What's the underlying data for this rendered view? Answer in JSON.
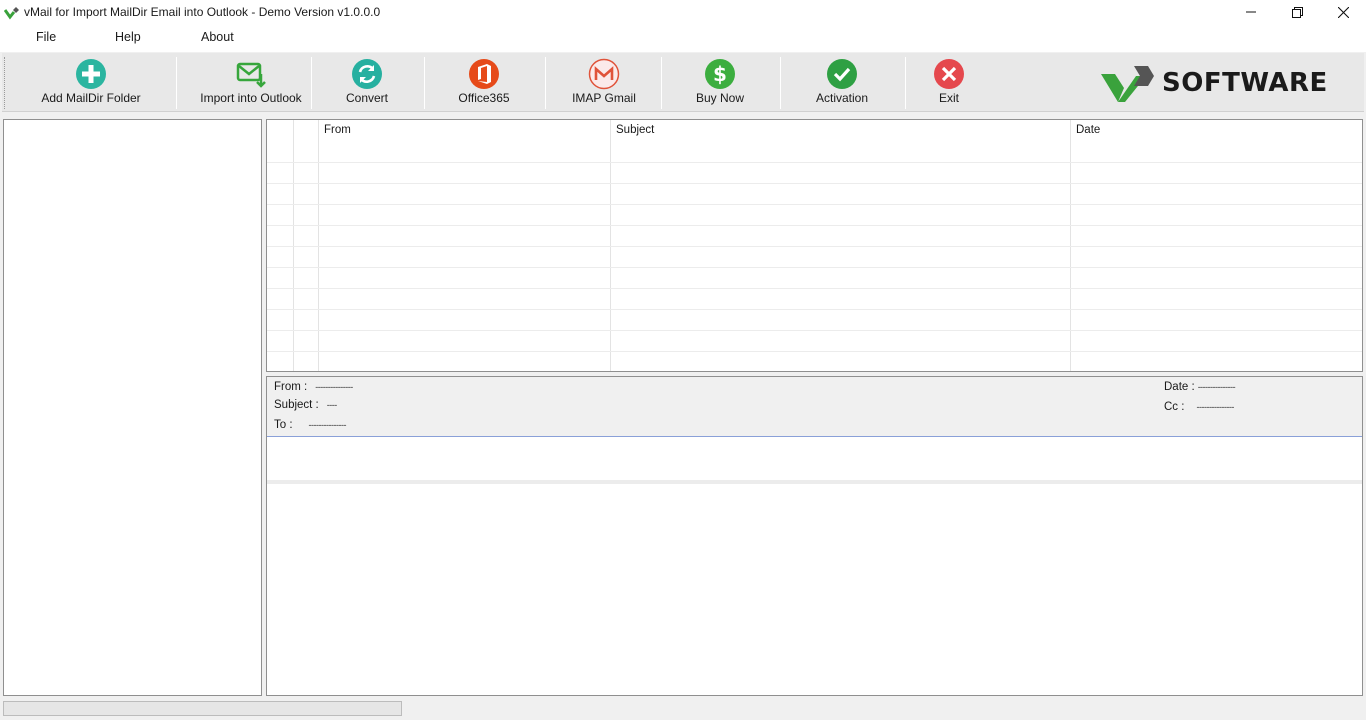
{
  "window": {
    "title": "vMail for Import MailDir Email into Outlook - Demo Version v1.0.0.0"
  },
  "menu": {
    "items": [
      {
        "label": "File"
      },
      {
        "label": "Help"
      },
      {
        "label": "About"
      }
    ]
  },
  "toolbar": {
    "buttons": [
      {
        "label": "Add MailDir Folder",
        "icon": "add-icon",
        "color": "#2bb5a0"
      },
      {
        "label": "Import into Outlook",
        "icon": "mail-import-icon",
        "color": "#37a63c"
      },
      {
        "label": "Convert",
        "icon": "convert-icon",
        "color": "#26b0a0"
      },
      {
        "label": "Office365",
        "icon": "office365-icon",
        "color": "#e64a19"
      },
      {
        "label": "IMAP Gmail",
        "icon": "gmail-icon",
        "color": "#e0533a"
      },
      {
        "label": "Buy Now",
        "icon": "dollar-icon",
        "color": "#3cae3f"
      },
      {
        "label": "Activation",
        "icon": "check-icon",
        "color": "#2ea043"
      },
      {
        "label": "Exit",
        "icon": "exit-icon",
        "color": "#e5484d"
      }
    ],
    "logo_text": "SOFTWARE"
  },
  "email_grid": {
    "columns": [
      "From",
      "Subject",
      "Date"
    ],
    "rows": []
  },
  "preview": {
    "from_label": "From :",
    "from_value": "---------------",
    "subject_label": "Subject :",
    "subject_value": "----",
    "to_label": "To :",
    "to_value": "---------------",
    "date_label": "Date :",
    "date_value": "---------------",
    "cc_label": "Cc :",
    "cc_value": "---------------"
  },
  "status": {
    "progress_fraction": 0
  }
}
